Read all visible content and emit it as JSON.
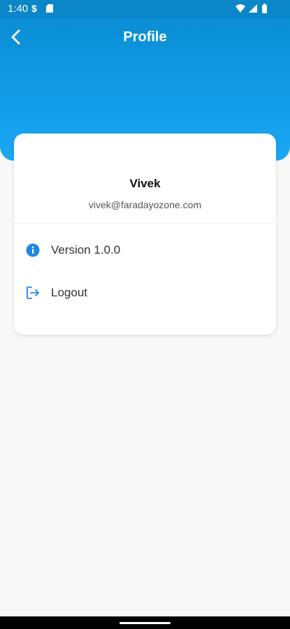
{
  "status_bar": {
    "time": "1:40",
    "notification_icons": [
      "s-icon",
      "sd-card-icon"
    ],
    "right_icons": [
      "wifi-icon",
      "signal-icon",
      "battery-icon"
    ]
  },
  "header": {
    "title": "Profile",
    "back_icon": "chevron-left-icon"
  },
  "profile": {
    "name": "Vivek",
    "email": "vivek@faradayozone.com"
  },
  "menu": {
    "version": {
      "label": "Version 1.0.0",
      "icon": "info-icon"
    },
    "logout": {
      "label": "Logout",
      "icon": "logout-icon"
    }
  },
  "colors": {
    "primary": "#0a86c9",
    "header_gradient_top": "#0a8ed4",
    "header_gradient_bottom": "#1aa7f5",
    "icon_accent": "#1e88e5",
    "background": "#f8f8f8"
  }
}
